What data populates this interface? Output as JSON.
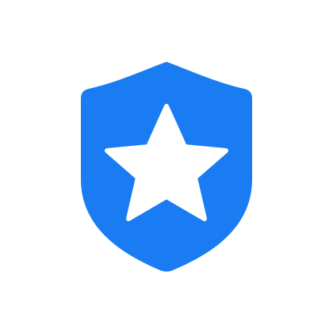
{
  "icon": {
    "name": "shield-star-icon",
    "shield_color": "#1a7cf2",
    "star_color": "#ffffff",
    "background_color": "#ffffff"
  }
}
